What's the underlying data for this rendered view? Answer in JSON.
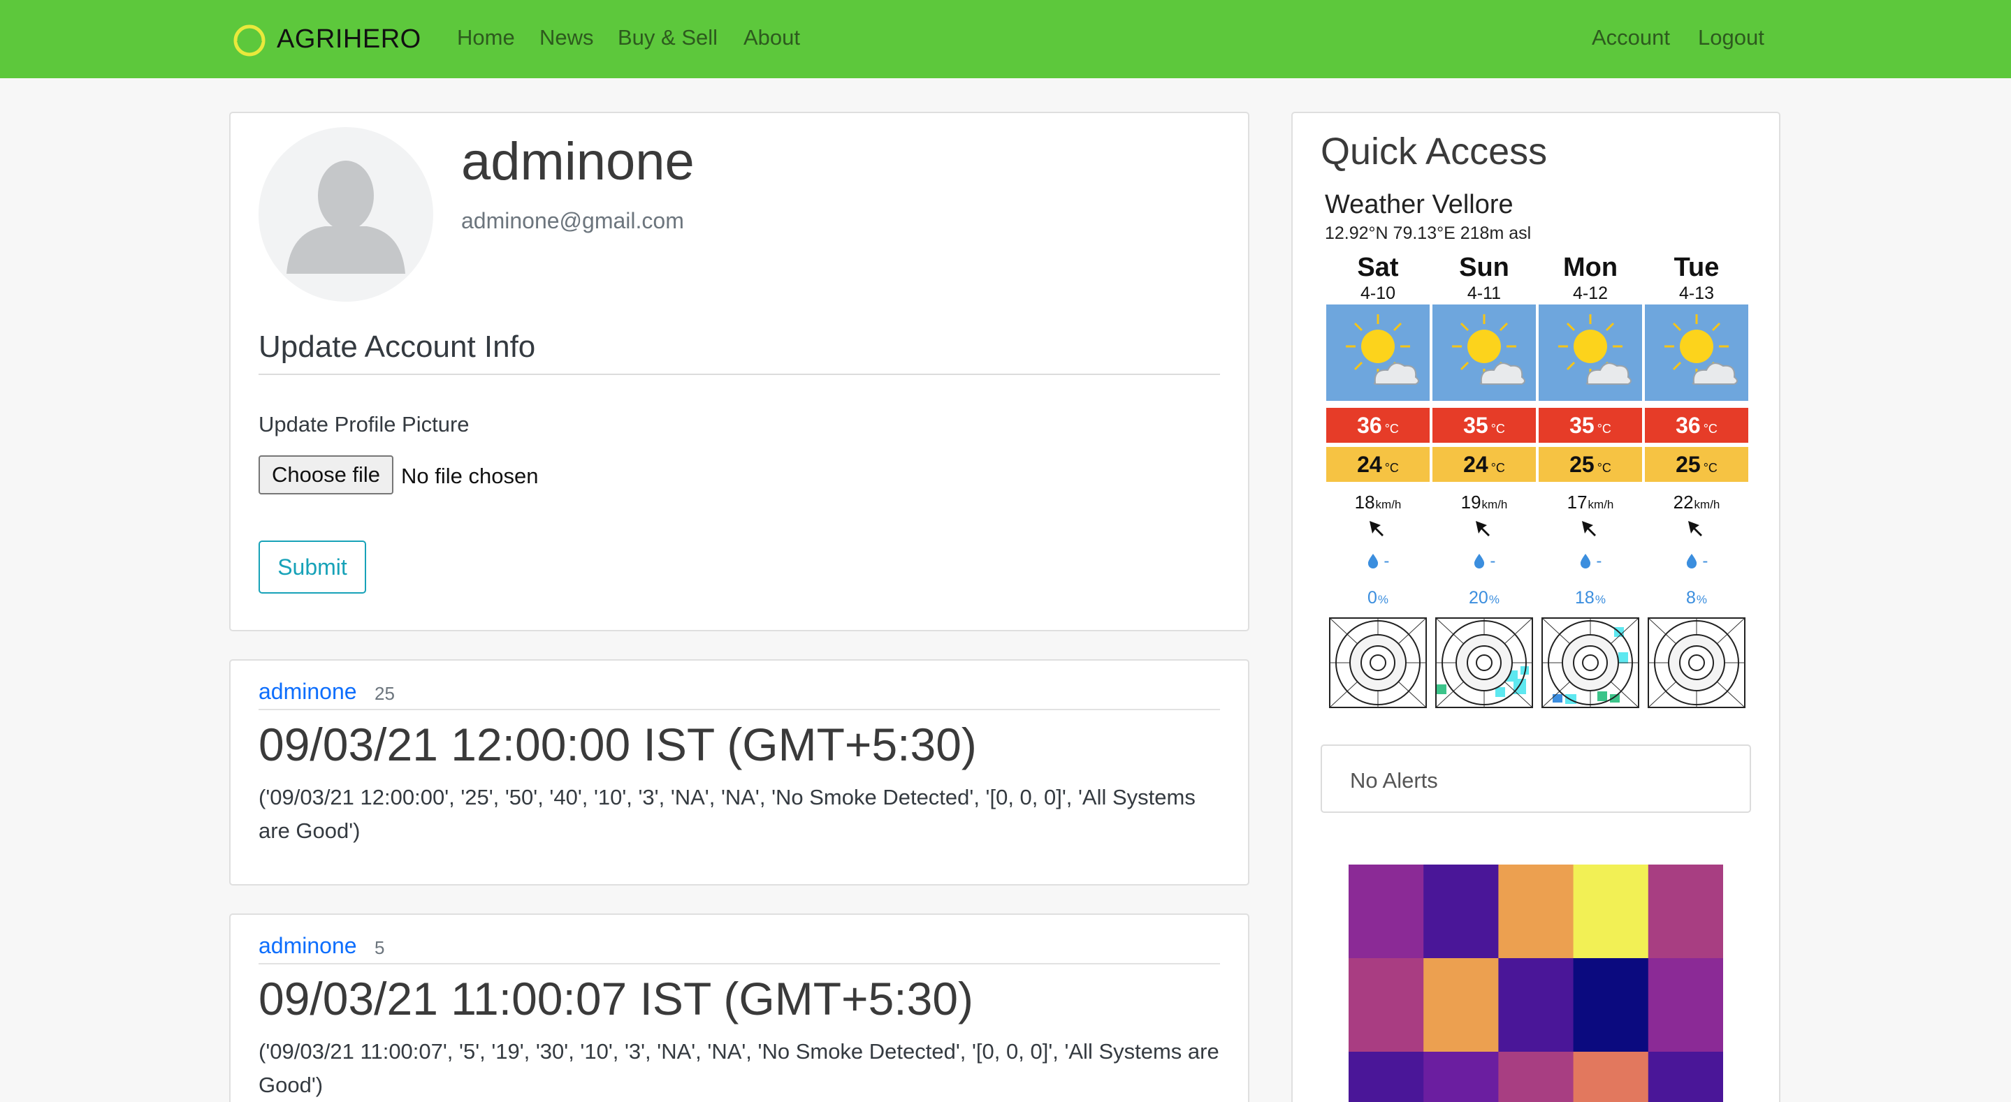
{
  "navbar": {
    "brand": "AGRIHERO",
    "links": [
      "Home",
      "News",
      "Buy & Sell",
      "About"
    ],
    "right_links": [
      "Account",
      "Logout"
    ],
    "color": "#5dc83c"
  },
  "profile": {
    "username": "adminone",
    "email": "adminone@gmail.com",
    "section_title": "Update Account Info",
    "picture_label": "Update Profile Picture",
    "choose_file": "Choose file",
    "file_status": "No file chosen",
    "submit": "Submit"
  },
  "posts": [
    {
      "author": "adminone",
      "count": "25",
      "title": "09/03/21 12:00:00 IST (GMT+5:30)",
      "body": "('09/03/21 12:00:00', '25', '50', '40', '10', '3', 'NA', 'NA', 'No Smoke Detected', '[0, 0, 0]', 'All Systems are Good')"
    },
    {
      "author": "adminone",
      "count": "5",
      "title": "09/03/21 11:00:07 IST (GMT+5:30)",
      "body": "('09/03/21 11:00:07', '5', '19', '30', '10', '3', 'NA', 'NA', 'No Smoke Detected', '[0, 0, 0]', 'All Systems are Good')"
    }
  ],
  "quick_access": {
    "title": "Quick Access",
    "weather": {
      "title": "Weather Vellore",
      "coords": "12.92°N 79.13°E 218m asl",
      "temp_unit": "°C",
      "wind_unit": "km/h",
      "prob_unit": "%",
      "days": [
        {
          "day": "Sat",
          "date": "4-10",
          "max": "36",
          "min": "24",
          "wind": "18",
          "rain": "-",
          "prob": "0",
          "icon": "sun-cloud-icon"
        },
        {
          "day": "Sun",
          "date": "4-11",
          "max": "35",
          "min": "24",
          "wind": "19",
          "rain": "-",
          "prob": "20",
          "icon": "sun-cloud-icon"
        },
        {
          "day": "Mon",
          "date": "4-12",
          "max": "35",
          "min": "25",
          "wind": "17",
          "rain": "-",
          "prob": "18",
          "icon": "sun-cloud-icon"
        },
        {
          "day": "Tue",
          "date": "4-13",
          "max": "36",
          "min": "25",
          "wind": "22",
          "rain": "-",
          "prob": "8",
          "icon": "sun-cloud-icon"
        }
      ],
      "colors": {
        "max": "#e63c28",
        "min": "#f6c343",
        "icon_bg": "#6ea6dd",
        "rain": "#3b8ede"
      }
    },
    "alerts": "No Alerts",
    "heatmap_colors": [
      [
        "#8b2a96",
        "#4a1698",
        "#eca050",
        "#f2f055",
        "#a83e82"
      ],
      [
        "#a93d82",
        "#eca050",
        "#4a1698",
        "#0b0a7f",
        "#8b2a96"
      ],
      [
        "#4a1698",
        "#6b1ea0",
        "#a83e82",
        "#e2785e",
        "#4a1698"
      ]
    ]
  }
}
